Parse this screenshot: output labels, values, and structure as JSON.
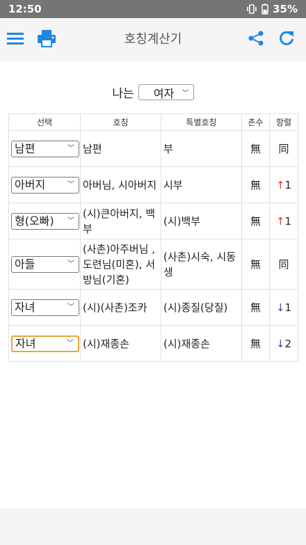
{
  "status_bar": {
    "time": "12:50",
    "battery": "35%"
  },
  "app_bar": {
    "title": "호칭계산기"
  },
  "gender": {
    "label": "나는",
    "value": "여자"
  },
  "table": {
    "headers": [
      "선택",
      "호칭",
      "특별호칭",
      "촌수",
      "항렬"
    ],
    "rows": [
      {
        "select": "남편",
        "title": "남편",
        "special": "부",
        "chonsu": "無",
        "hang_arrow": "",
        "hang_value": "同",
        "hang_dir": "same"
      },
      {
        "select": "아버지",
        "title": "아버님, 시아버지",
        "special": "시부",
        "chonsu": "無",
        "hang_arrow": "↑",
        "hang_value": "1",
        "hang_dir": "up"
      },
      {
        "select": "형(오빠)",
        "title": "(시)큰아버지, 백부",
        "special": "(시)백부",
        "chonsu": "無",
        "hang_arrow": "↑",
        "hang_value": "1",
        "hang_dir": "up"
      },
      {
        "select": "아들",
        "title": "(사촌)아주버님 , 도련님(미혼), 서방님(기혼)",
        "special": "(사촌)시숙, 시동생",
        "chonsu": "無",
        "hang_arrow": "",
        "hang_value": "同",
        "hang_dir": "same"
      },
      {
        "select": "자녀",
        "title": "(시)(사촌)조카",
        "special": "(시)종질(당질)",
        "chonsu": "無",
        "hang_arrow": "↓",
        "hang_value": "1",
        "hang_dir": "down"
      },
      {
        "select": "자녀",
        "title": "(시)재종손",
        "special": "(시)재종손",
        "chonsu": "無",
        "hang_arrow": "↓",
        "hang_value": "2",
        "hang_dir": "down"
      }
    ]
  },
  "colors": {
    "accent": "#1e88e5",
    "status_bar": "#757575",
    "focus": "#e8a33a",
    "up": "#e53935",
    "down": "#3949ab"
  },
  "icons": [
    "menu-icon",
    "print-icon",
    "share-icon",
    "refresh-icon",
    "vibrate-icon",
    "battery-icon",
    "chevron-down-icon"
  ]
}
